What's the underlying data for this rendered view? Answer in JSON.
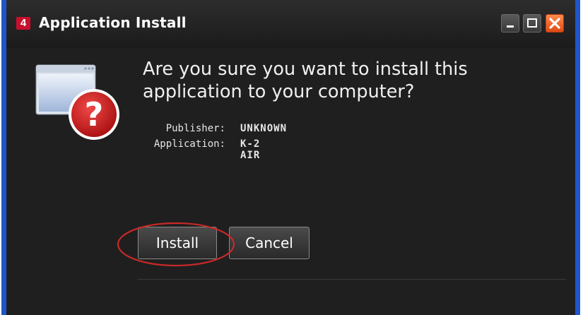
{
  "window": {
    "title": "Application Install",
    "app_icon_label": "4",
    "controls": {
      "minimize": "minimize-icon",
      "maximize": "maximize-icon",
      "close": "close-icon"
    }
  },
  "dialog": {
    "question": "Are you sure you want to install this application to your computer?",
    "publisher": {
      "label": "Publisher:",
      "value": "UNKNOWN"
    },
    "application": {
      "label": "Application:",
      "value": "K-2 AIR"
    },
    "buttons": {
      "install": "Install",
      "cancel": "Cancel"
    }
  },
  "colors": {
    "frame": "#1f56c9",
    "background": "#1f1f1f",
    "close_button": "#e04a14",
    "warning_badge": "#c8102e",
    "highlight_ring": "#c82828"
  },
  "icons": {
    "hero": "window-question-icon"
  }
}
